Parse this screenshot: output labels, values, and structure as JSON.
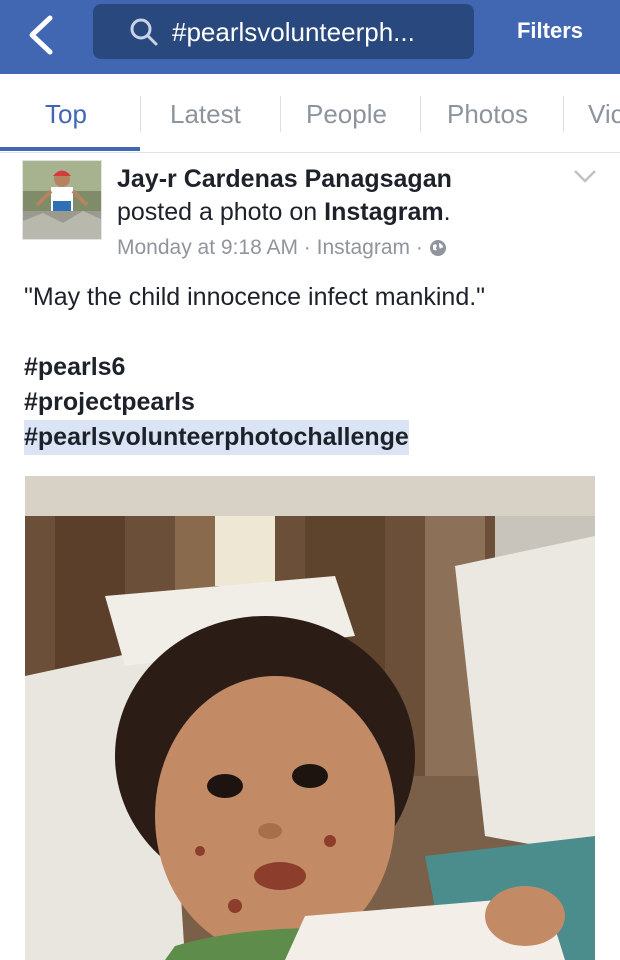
{
  "header": {
    "back_label": "Back",
    "search_text": "#pearlsvolunteerph...",
    "filters_label": "Filters",
    "colors": {
      "bar": "#4267b2",
      "search_bg": "#29487d"
    }
  },
  "tabs": [
    {
      "label": "Top",
      "active": true
    },
    {
      "label": "Latest",
      "active": false
    },
    {
      "label": "People",
      "active": false
    },
    {
      "label": "Photos",
      "active": false
    },
    {
      "label": "Vic",
      "active": false
    }
  ],
  "post": {
    "author": "Jay-r Cardenas Panagsagan",
    "action_prefix": "posted a photo on ",
    "action_platform": "Instagram",
    "action_suffix": ".",
    "time": "Monday at 9:18 AM",
    "separator": " · ",
    "source": "Instagram",
    "privacy_icon": "globe-icon",
    "quote": "\"May the child innocence infect mankind.\"",
    "hashtags": [
      "#pearls6",
      "#projectpearls",
      "#pearlsvolunteerphotochallenge"
    ],
    "highlighted_hashtag_index": 2
  }
}
